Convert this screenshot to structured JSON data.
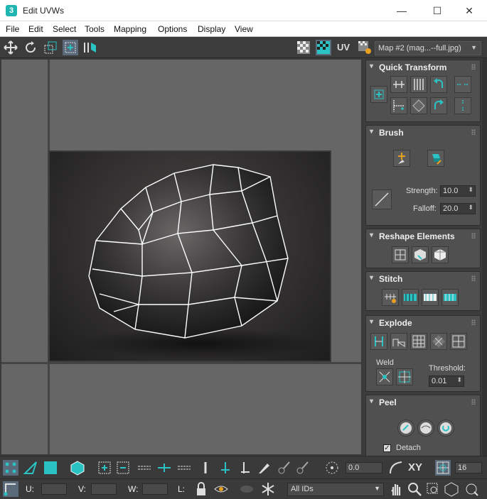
{
  "window": {
    "title": "Edit UVWs",
    "app_icon": "3",
    "minimize": "—",
    "maximize": "☐",
    "close": "✕"
  },
  "menu": [
    "File",
    "Edit",
    "Select",
    "Tools",
    "Mapping",
    "Options",
    "Display",
    "View"
  ],
  "toolbar": {
    "uv_label": "UV",
    "map_select": "Map #2 (mag...--full.jpg)"
  },
  "panels": {
    "quick_transform": {
      "title": "Quick Transform"
    },
    "brush": {
      "title": "Brush",
      "strength_label": "Strength:",
      "strength_value": "10.0",
      "falloff_label": "Falloff:",
      "falloff_value": "20.0"
    },
    "reshape": {
      "title": "Reshape Elements"
    },
    "stitch": {
      "title": "Stitch"
    },
    "explode": {
      "title": "Explode",
      "weld_label": "Weld",
      "threshold_label": "Threshold:",
      "threshold_value": "0.01"
    },
    "peel": {
      "title": "Peel",
      "detach_label": "Detach",
      "detach_checked": true
    }
  },
  "bottom_toolbar": {
    "angle_value": "0.0",
    "xy_label": "XY",
    "grid_value": "16",
    "u_label": "U:",
    "v_label": "V:",
    "w_label": "W:",
    "l_label": "L:",
    "ids_select": "All IDs"
  },
  "colors": {
    "accent": "#2ac2c2",
    "panel": "#505050",
    "bg": "#3c3c3c"
  }
}
